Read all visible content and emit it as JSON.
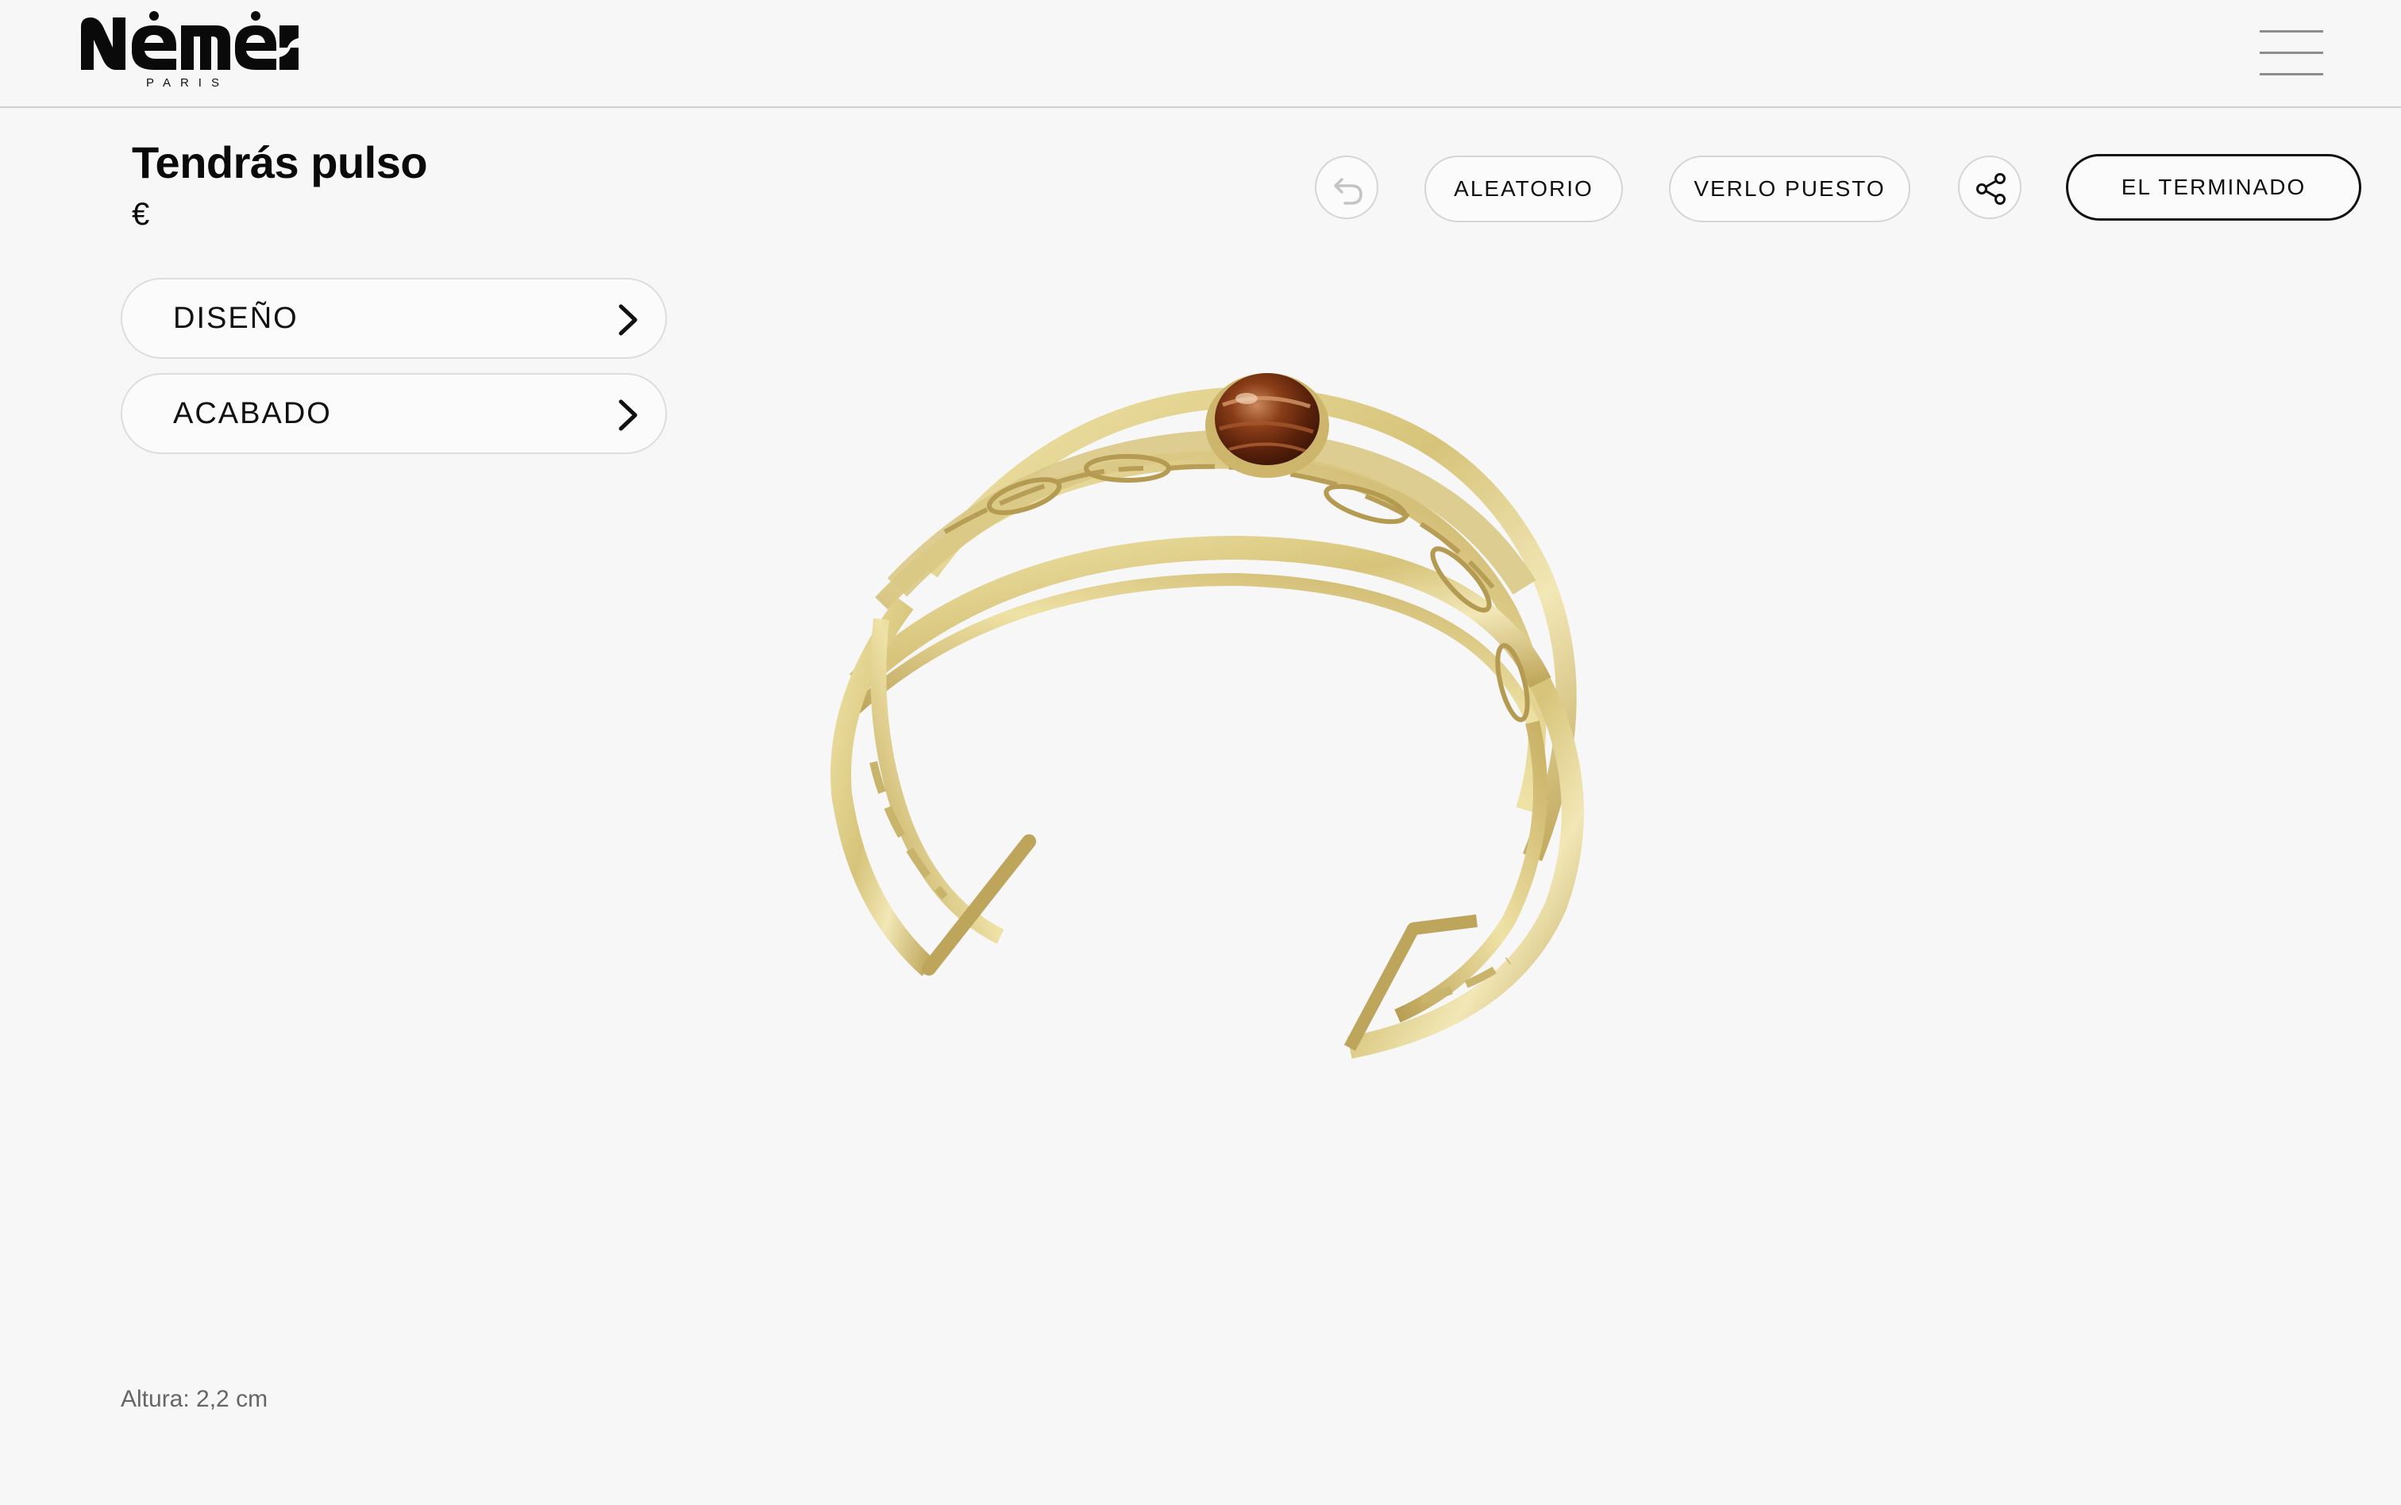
{
  "header": {
    "brand": "Némés",
    "brand_sub": "PARIS",
    "menu_icon": "hamburger-menu-icon"
  },
  "product": {
    "title": "Tendrás pulso",
    "price": "€",
    "image_alt": "Brazalete dorado con piedra ojo de tigre"
  },
  "options": [
    {
      "label": "DISEÑO",
      "icon": "chevron-right-icon"
    },
    {
      "label": "ACABADO",
      "icon": "chevron-right-icon"
    }
  ],
  "actions": {
    "undo_icon": "undo-icon",
    "random_label": "ALEATORIO",
    "try_on_label": "VERLO PUESTO",
    "share_icon": "share-icon",
    "finish_label": "EL TERMINADO"
  },
  "info": {
    "height": "Altura: 2,2 cm"
  },
  "colors": {
    "background": "#f7f7f7",
    "gold": "#d6c27a",
    "stone": "#7a3412",
    "text": "#0a0a0a"
  }
}
